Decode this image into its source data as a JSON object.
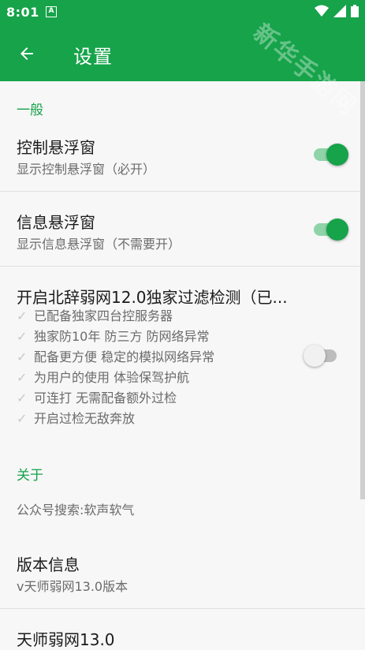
{
  "status_bar": {
    "time": "8:01",
    "notif_icon_letter": "A"
  },
  "toolbar": {
    "title": "设置"
  },
  "watermark": "新华手游网",
  "sections": {
    "general_header": "一般",
    "about_header": "关于"
  },
  "prefs": {
    "float_control": {
      "title": "控制悬浮窗",
      "summary": "显示控制悬浮窗（必开）",
      "enabled": true
    },
    "float_info": {
      "title": "信息悬浮窗",
      "summary": "显示信息悬浮窗（不需要开）",
      "enabled": true
    },
    "filter": {
      "title": "开启北辞弱网12.0独家过滤检测（已...",
      "enabled": false,
      "features": [
        "已配备独家四台控服务器",
        "独家防10年 防三方 防网络异常",
        "配备更方便 稳定的模拟网络异常",
        "为用户的使用 体验保驾护航",
        "可连打 无需配备额外过检",
        "开启过检无敌奔放"
      ]
    },
    "public_account": {
      "summary": "公众号搜索:软声软气"
    },
    "version": {
      "title": "版本信息",
      "summary": "v天师弱网13.0版本"
    },
    "app_name": {
      "title": "天师弱网13.0"
    }
  },
  "colors": {
    "accent": "#16a34a",
    "accent_light": "#8fd4a8"
  },
  "icons": {
    "back": "arrow-back-icon",
    "check": "check-icon"
  }
}
